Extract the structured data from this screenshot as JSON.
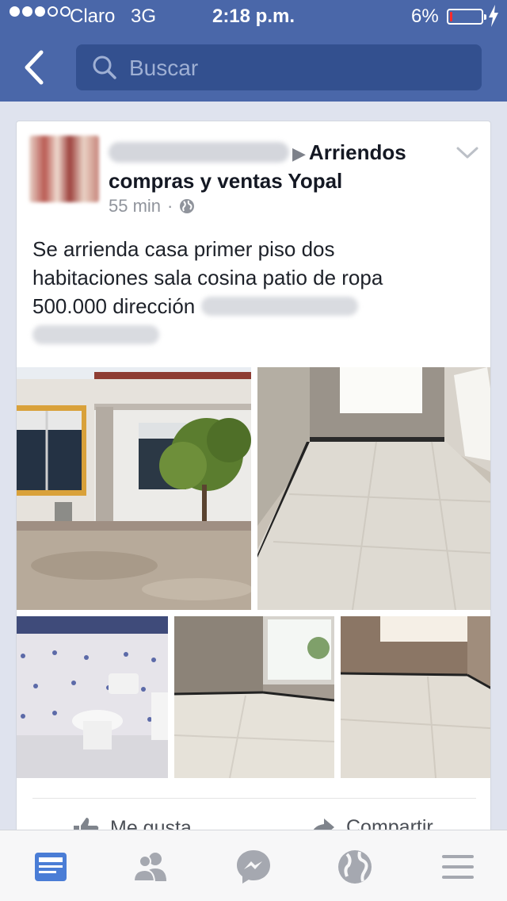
{
  "status_bar": {
    "carrier": "Claro",
    "network": "3G",
    "time": "2:18 p.m.",
    "battery_percent": "6%",
    "battery_level": 0.06,
    "battery_color": "#ff2b2b"
  },
  "header": {
    "back_icon": "chevron-left-icon",
    "search": {
      "placeholder": "Buscar",
      "value": ""
    },
    "colors": {
      "bar": "#4a67a9",
      "search_field": "#33508f"
    }
  },
  "post": {
    "author_name_redacted": true,
    "group_name": "Arriendos compras y ventas Yopal",
    "timestamp": "55 min",
    "separator": "·",
    "privacy_icon": "globe-icon",
    "options_icon": "chevron-down-icon",
    "body_lines": [
      "Se arrienda casa primer piso dos",
      "habitaciones sala cosina patio de ropa",
      "500.000  dirección"
    ],
    "photos": [
      {
        "label": "house-exterior-photo"
      },
      {
        "label": "empty-room-photo"
      },
      {
        "label": "bathroom-photo"
      },
      {
        "label": "bedroom-photo"
      },
      {
        "label": "room-photo"
      }
    ],
    "actions": {
      "like": {
        "label": "Me gusta",
        "icon": "thumbs-up-icon"
      },
      "share": {
        "label": "Compartir",
        "icon": "share-arrow-icon"
      }
    }
  },
  "tabbar": {
    "tabs": [
      {
        "icon": "news-feed-icon",
        "active": true
      },
      {
        "icon": "friends-icon",
        "active": false
      },
      {
        "icon": "messenger-icon",
        "active": false
      },
      {
        "icon": "globe-notifications-icon",
        "active": false
      },
      {
        "icon": "menu-icon",
        "active": false
      }
    ],
    "colors": {
      "active": "#4a7dd6",
      "inactive": "#a5a8b0"
    }
  }
}
